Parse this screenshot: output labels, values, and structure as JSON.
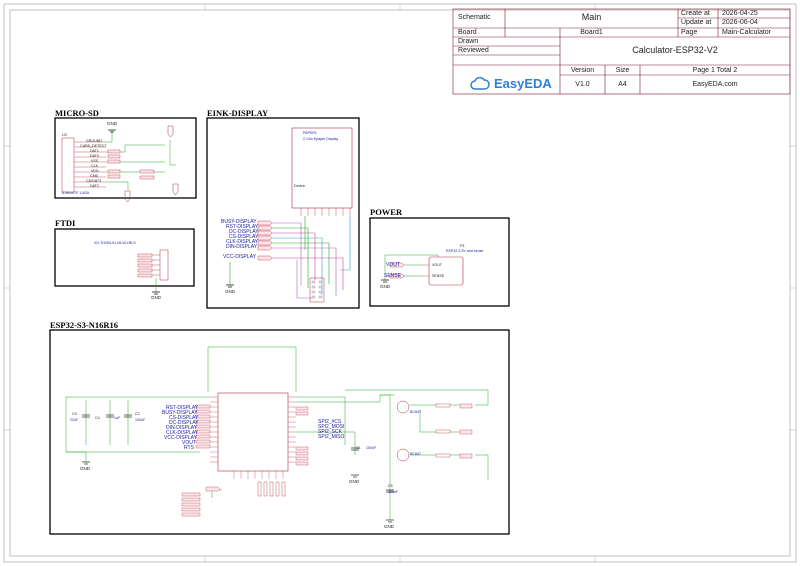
{
  "title_block": {
    "schematic_label": "Schematic",
    "main_value": "Main",
    "create_label": "Create at",
    "create_value": "2026-04-25",
    "board_label": "Board",
    "board_value": "Board1",
    "update_label": "Update at",
    "update_value": "2026-06-04",
    "page_label": "Page",
    "page_value": "Main-Calculator",
    "drawn_label": "Drawn",
    "reviewed_label": "Reviewed",
    "project_title": "Calculator-ESP32-V2",
    "version_label": "Version",
    "size_label": "Size",
    "version_value": "V1.0",
    "size_value": "A4",
    "page_count": "Page  1  Total  2",
    "logo_text": "EasyEDA",
    "website": "EasyEDA.com"
  },
  "blocks": {
    "micro_sd": "MICRO-SD",
    "eink": "EINK-DISPLAY",
    "ftdi": "FTDI",
    "power": "POWER",
    "esp32": "ESP32-S3-N16R16"
  },
  "eink_nets": [
    "BUSY-DISPLAY",
    "RST-DISPLAY",
    "DC-DISPLAY",
    "CS-DISPLAY",
    "CLK-DISPLAY",
    "DIN-DISPLAY",
    "VCC-DISPLAY"
  ],
  "esp_nets_left": [
    "RST-DISPLAY",
    "BUSY-DISPLAY",
    "CS-DISPLAY",
    "DC-DISPLAY",
    "DIN-DISPLAY",
    "CLK-DISPLAY",
    "VCC-DISPLAY",
    "VOUT",
    "RTS"
  ],
  "esp_nets_right": [
    "SPI2_#CS",
    "SPI2_MOSI",
    "SPI2_SCK",
    "SPI2_MISO"
  ],
  "power_nets": [
    "VOUT",
    "SENSE"
  ],
  "gnd_label": "GND",
  "power_part": "P1",
  "power_part_desc": "ESP32-3.3V and sense",
  "power_pins": [
    "VOUT",
    "SENSE"
  ],
  "eink_part": "PAPER1",
  "eink_desc": "2.13in Epaper Display",
  "eink_device": "Device",
  "sd_part": "U2",
  "sd_pins": [
    "GROUND",
    "CARD_DETECT",
    "DAT1",
    "DAT0",
    "VSS",
    "CLK",
    "VDD",
    "CMD",
    "CD/DAT3",
    "DAT2"
  ],
  "sd_desc": "A MicroTF 1.8SA",
  "ftdi_part": "FTDI",
  "ftdi_desc": "XH-TH254-01-06-W-HB-S",
  "caps": [
    {
      "ref": "C3",
      "value": "22uF"
    },
    {
      "ref": "C4",
      "value": "1uF"
    },
    {
      "ref": "C2",
      "value": "100nF"
    },
    {
      "ref": "C1",
      "value": "100nF"
    },
    {
      "ref": "C5",
      "value": "100nF"
    }
  ],
  "transistors": [
    "Q1",
    "Q2"
  ],
  "transistor_part": "BC847",
  "resistors": [
    "R1",
    "R2",
    "R3",
    "R4"
  ],
  "resistor_value": "10K"
}
